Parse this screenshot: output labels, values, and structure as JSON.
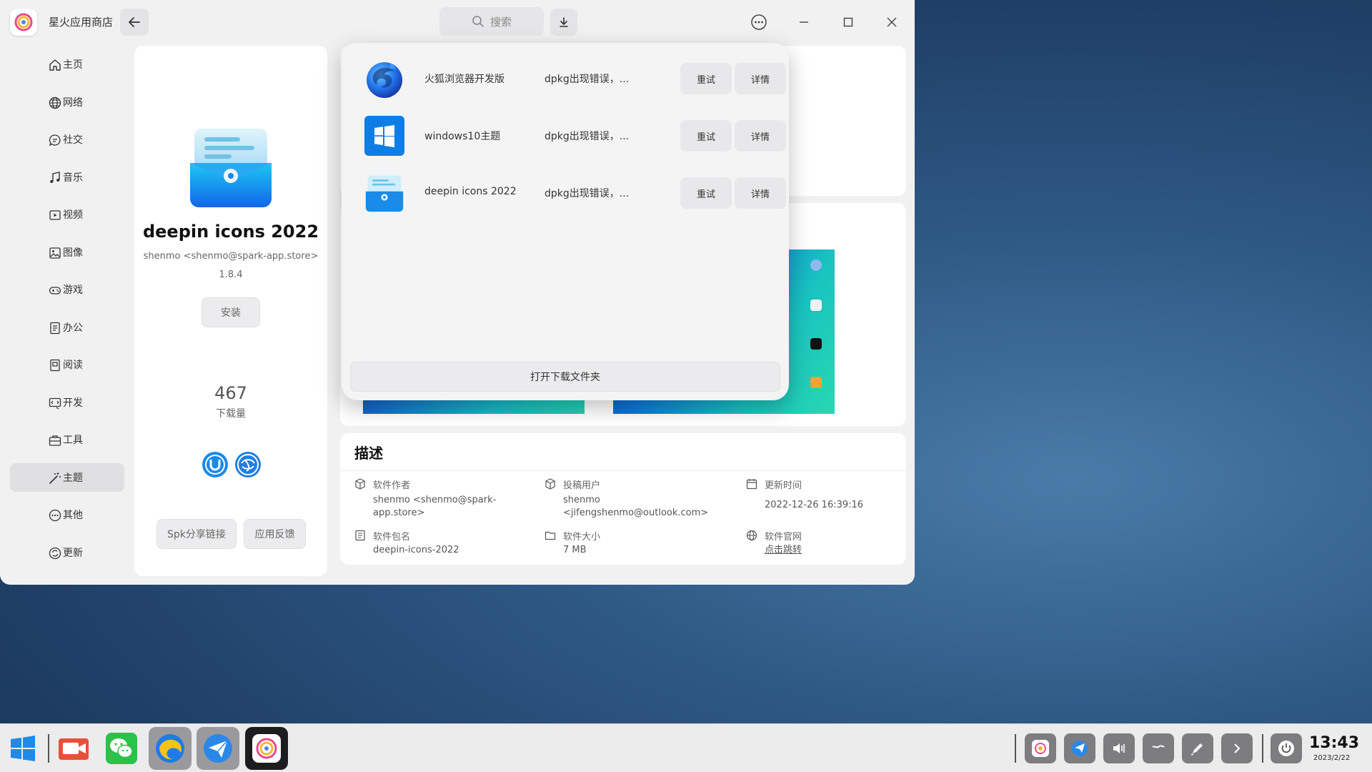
{
  "app": {
    "title": "星火应用商店"
  },
  "search": {
    "placeholder": "搜索"
  },
  "sidebar": {
    "items": [
      {
        "label": "主页",
        "icon": "home-icon"
      },
      {
        "label": "网络",
        "icon": "globe-icon"
      },
      {
        "label": "社交",
        "icon": "chat-icon"
      },
      {
        "label": "音乐",
        "icon": "music-note-icon"
      },
      {
        "label": "视频",
        "icon": "video-icon"
      },
      {
        "label": "图像",
        "icon": "image-icon"
      },
      {
        "label": "游戏",
        "icon": "gamepad-icon"
      },
      {
        "label": "办公",
        "icon": "document-icon"
      },
      {
        "label": "阅读",
        "icon": "book-icon"
      },
      {
        "label": "开发",
        "icon": "code-icon"
      },
      {
        "label": "工具",
        "icon": "toolbox-icon"
      },
      {
        "label": "主题",
        "icon": "magic-wand-icon",
        "active": true
      },
      {
        "label": "其他",
        "icon": "more-icon"
      },
      {
        "label": "更新",
        "icon": "update-icon"
      }
    ]
  },
  "app_detail": {
    "name": "deepin icons 2022",
    "author": "shenmo <shenmo@spark-app.store>",
    "version": "1.8.4",
    "install_label": "安装",
    "downloads": "467",
    "downloads_label": "下载量",
    "share_label": "Spk分享链接",
    "feedback_label": "应用反馈"
  },
  "downloads_popup": {
    "items": [
      {
        "name": "火狐浏览器开发版",
        "status": "dpkg出现错误，...",
        "retry": "重试",
        "details": "详情",
        "icon": "firefox-dev-icon"
      },
      {
        "name": "windows10主题",
        "status": "dpkg出现错误，...",
        "retry": "重试",
        "details": "详情",
        "icon": "windows-logo-icon"
      },
      {
        "name": "deepin icons 2022",
        "status": "dpkg出现错误，...",
        "retry": "重试",
        "details": "详情",
        "icon": "deepin-icons-icon"
      }
    ],
    "open_folder_label": "打开下载文件夹"
  },
  "description": {
    "title": "描述",
    "author_label": "软件作者",
    "author_value": "shenmo <shenmo@spark-",
    "author_value2": "app.store>",
    "uploader_label": "投稿用户",
    "uploader_value": "shenmo",
    "uploader_value2": "<jifengshenmo@outlook.com>",
    "updated_label": "更新时间",
    "updated_value": "2022-12-26 16:39:16",
    "package_label": "软件包名",
    "package_value": "deepin-icons-2022",
    "size_label": "软件大小",
    "size_value": "7 MB",
    "website_label": "软件官网",
    "website_value": "点击跳转"
  },
  "taskbar": {
    "time": "13:43",
    "date": "2023/2/22"
  },
  "colors": {
    "accent_blue": "#1a63d6",
    "window_bg": "#f1f1f2"
  }
}
